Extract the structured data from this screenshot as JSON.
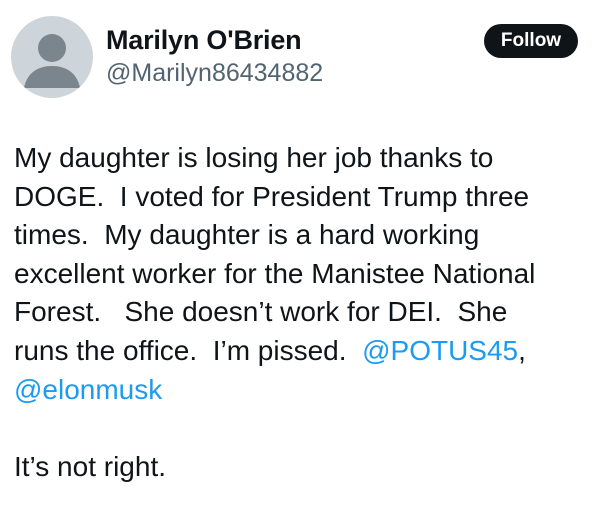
{
  "author": {
    "display_name": "Marilyn O'Brien",
    "handle": "@Marilyn86434882",
    "avatar_icon": "default-profile-icon"
  },
  "follow_button": {
    "label": "Follow"
  },
  "tweet": {
    "lines": {
      "l1": "My daughter is losing her job thanks to",
      "l2": "DOGE.  I voted for President Trump three",
      "l3": "times.  My daughter is a hard working",
      "l4": "excellent worker for the Manistee National",
      "l5": "Forest.   She doesn’t work for DEI.  She",
      "l6_text": "runs the office.  I’m pissed.  ",
      "l6_mention": "@POTUS45",
      "l6_suffix": ",",
      "l7_mention": "@elonmusk",
      "l9": "It’s not right."
    }
  },
  "colors": {
    "text": "#0f1419",
    "secondary": "#536471",
    "mention": "#1d9bf0",
    "button_bg": "#0f1419",
    "avatar_bg": "#ced5da"
  }
}
